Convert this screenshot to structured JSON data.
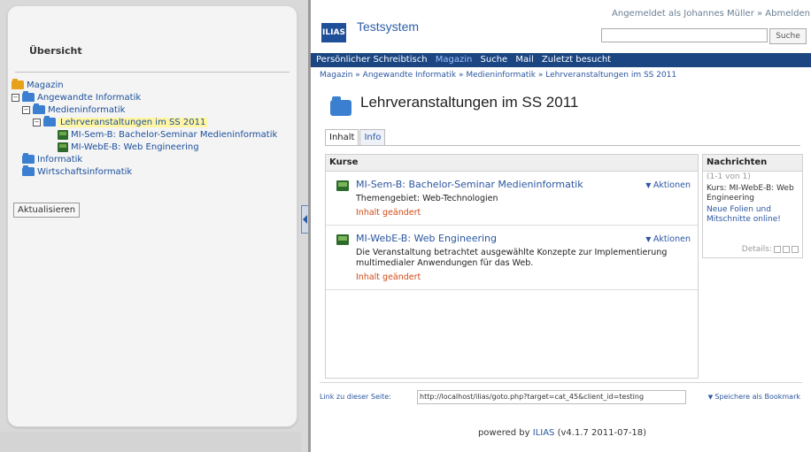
{
  "left": {
    "title": "Übersicht",
    "tree": [
      {
        "label": "Magazin"
      },
      {
        "label": "Angewandte Informatik"
      },
      {
        "label": "Medieninformatik"
      },
      {
        "label": "Lehrveranstaltungen im SS 2011"
      },
      {
        "label": "MI-Sem-B: Bachelor-Seminar Medieninformatik"
      },
      {
        "label": "MI-WebE-B: Web Engineering"
      },
      {
        "label": "Informatik"
      },
      {
        "label": "Wirtschaftsinformatik"
      }
    ],
    "refresh_label": "Aktualisieren"
  },
  "header": {
    "logo": "ILIAS",
    "app_title": "Testsystem",
    "logged_in_prefix": "Angemeldet als Johannes Müller » ",
    "logout": "Abmelden",
    "search_button": "Suche"
  },
  "nav": {
    "items": [
      "Persönlicher Schreibtisch",
      "Magazin",
      "Suche",
      "Mail",
      "Zuletzt besucht"
    ]
  },
  "breadcrumb": "Magazin » Angewandte Informatik » Medieninformatik » Lehrveranstaltungen im SS 2011",
  "page_title": "Lehrveranstaltungen im SS 2011",
  "tabs": [
    "Inhalt",
    "Info"
  ],
  "kurse": {
    "header": "Kurse",
    "courses": [
      {
        "title": "MI-Sem-B: Bachelor-Seminar Medieninformatik",
        "desc": "Themengebiet: Web-Technologien",
        "status": "Inhalt geändert",
        "actions": "Aktionen"
      },
      {
        "title": "MI-WebE-B: Web Engineering",
        "desc": "Die Veranstaltung betrachtet ausgewählte Konzepte zur Implementierung multimedialer Anwendungen für das Web.",
        "status": "Inhalt geändert",
        "actions": "Aktionen"
      }
    ]
  },
  "news": {
    "header": "Nachrichten",
    "count": "(1-1 von 1)",
    "text": "Kurs: MI-WebE-B: Web Engineering",
    "link": "Neue Folien und Mitschnitte online!",
    "details": "Details:"
  },
  "footer": {
    "link_label": "Link zu dieser Seite:",
    "link_value": "http://localhost/ilias/goto.php?target=cat_45&client_id=testing",
    "bookmark": "Speichere als Bookmark",
    "powered_prefix": "powered by ",
    "powered_link": "ILIAS",
    "powered_suffix": " (v4.1.7 2011-07-18)"
  }
}
